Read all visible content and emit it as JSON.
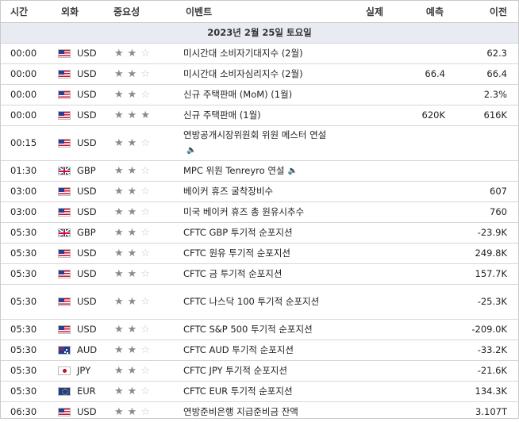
{
  "headers": {
    "time": "시간",
    "currency": "외화",
    "importance": "중요성",
    "event": "이벤트",
    "actual": "실제",
    "forecast": "예측",
    "previous": "이전"
  },
  "day_label": "2023년 2월 25일 토요일",
  "rows": [
    {
      "time": "00:00",
      "flag": "us",
      "currency": "USD",
      "stars": 2,
      "event": "미시간대 소비자기대지수 (2월)",
      "speaker": false,
      "actual": "",
      "forecast": "",
      "previous": "62.3"
    },
    {
      "time": "00:00",
      "flag": "us",
      "currency": "USD",
      "stars": 2,
      "event": "미시간대 소비자심리지수 (2월)",
      "speaker": false,
      "actual": "",
      "forecast": "66.4",
      "previous": "66.4"
    },
    {
      "time": "00:00",
      "flag": "us",
      "currency": "USD",
      "stars": 2,
      "event": "신규 주택판매 (MoM) (1월)",
      "speaker": false,
      "actual": "",
      "forecast": "",
      "previous": "2.3%"
    },
    {
      "time": "00:00",
      "flag": "us",
      "currency": "USD",
      "stars": 3,
      "event": "신규 주택판매 (1월)",
      "speaker": false,
      "actual": "",
      "forecast": "620K",
      "previous": "616K"
    },
    {
      "time": "00:15",
      "flag": "us",
      "currency": "USD",
      "stars": 2,
      "event": "연방공개시장위원회 위원 메스터 연설",
      "speaker": true,
      "actual": "",
      "forecast": "",
      "previous": "",
      "tall": true
    },
    {
      "time": "01:30",
      "flag": "gb",
      "currency": "GBP",
      "stars": 2,
      "event": "MPC 위원 Tenreyro 연설",
      "speaker": true,
      "actual": "",
      "forecast": "",
      "previous": ""
    },
    {
      "time": "03:00",
      "flag": "us",
      "currency": "USD",
      "stars": 2,
      "event": "베이커 휴즈 굴착장비수",
      "speaker": false,
      "actual": "",
      "forecast": "",
      "previous": "607"
    },
    {
      "time": "03:00",
      "flag": "us",
      "currency": "USD",
      "stars": 2,
      "event": "미국 베이커 휴즈 총 원유시추수",
      "speaker": false,
      "actual": "",
      "forecast": "",
      "previous": "760"
    },
    {
      "time": "05:30",
      "flag": "gb",
      "currency": "GBP",
      "stars": 2,
      "event": "CFTC GBP 투기적 순포지션",
      "speaker": false,
      "actual": "",
      "forecast": "",
      "previous": "-23.9K"
    },
    {
      "time": "05:30",
      "flag": "us",
      "currency": "USD",
      "stars": 2,
      "event": "CFTC 원유 투기적 순포지션",
      "speaker": false,
      "actual": "",
      "forecast": "",
      "previous": "249.8K"
    },
    {
      "time": "05:30",
      "flag": "us",
      "currency": "USD",
      "stars": 2,
      "event": "CFTC 금 투기적 순포지션",
      "speaker": false,
      "actual": "",
      "forecast": "",
      "previous": "157.7K"
    },
    {
      "time": "05:30",
      "flag": "us",
      "currency": "USD",
      "stars": 2,
      "event": "CFTC 나스닥 100 투기적 순포지션",
      "speaker": false,
      "actual": "",
      "forecast": "",
      "previous": "-25.3K",
      "tall": true
    },
    {
      "time": "05:30",
      "flag": "us",
      "currency": "USD",
      "stars": 2,
      "event": "CFTC S&P 500 투기적 순포지션",
      "speaker": false,
      "actual": "",
      "forecast": "",
      "previous": "-209.0K"
    },
    {
      "time": "05:30",
      "flag": "au",
      "currency": "AUD",
      "stars": 2,
      "event": "CFTC AUD 투기적 순포지션",
      "speaker": false,
      "actual": "",
      "forecast": "",
      "previous": "-33.2K"
    },
    {
      "time": "05:30",
      "flag": "jp",
      "currency": "JPY",
      "stars": 2,
      "event": "CFTC JPY 투기적 순포지션",
      "speaker": false,
      "actual": "",
      "forecast": "",
      "previous": "-21.6K"
    },
    {
      "time": "05:30",
      "flag": "eu",
      "currency": "EUR",
      "stars": 2,
      "event": "CFTC EUR 투기적 순포지션",
      "speaker": false,
      "actual": "",
      "forecast": "",
      "previous": "134.3K"
    },
    {
      "time": "06:30",
      "flag": "us",
      "currency": "USD",
      "stars": 2,
      "event": "연방준비은행 지급준비금 잔액",
      "speaker": false,
      "actual": "",
      "forecast": "",
      "previous": "3.107T"
    }
  ]
}
